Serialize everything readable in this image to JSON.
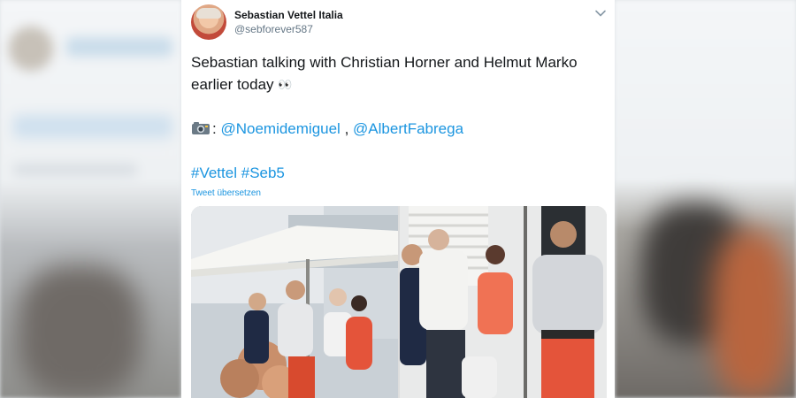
{
  "tweet": {
    "display_name": "Sebastian Vettel Italia",
    "handle": "@sebforever587",
    "text_line1": "Sebastian talking with Christian Horner and Helmut Marko earlier today",
    "eyes_emoji": "👀",
    "credit_separator": ":",
    "mention1": "@Noemidemiguel",
    "mention_separator": ",",
    "mention2": "@AlbertFabrega",
    "hashtag1": "#Vettel",
    "hashtag2": "#Seb5",
    "translate_label": "Tweet übersetzen"
  },
  "icons": {
    "avatar": "profile-avatar",
    "menu": "chevron-down-icon",
    "camera": "camera-icon"
  },
  "colors": {
    "link": "#1b95e0",
    "text": "#14171a",
    "secondary": "#657786"
  },
  "media": {
    "photo_count": 2
  }
}
